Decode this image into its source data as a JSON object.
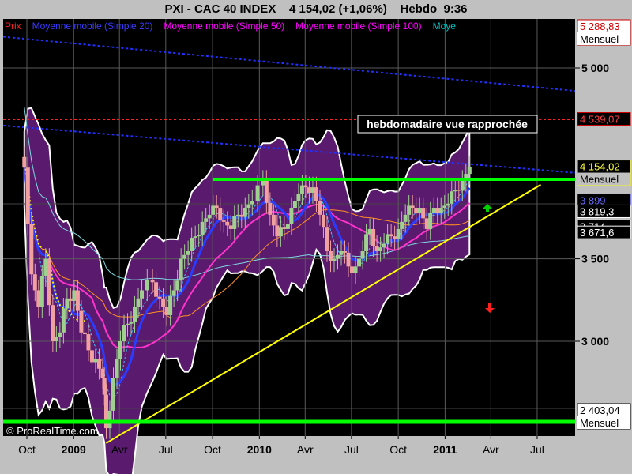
{
  "title": "PXI - CAC 40 INDEX    4 154,02 (+1,06%)    Hebdo  9:36",
  "watermark": "© ProRealTime.com",
  "annotation": "hebdomadaire vue rapprochée",
  "legend": [
    {
      "text": "Prix",
      "color": "#ff2020"
    },
    {
      "text": "Moyenne mobile (Simple 20)",
      "color": "#3a3aff"
    },
    {
      "text": "Moyenne mobile (Simple 50)",
      "color": "#ff00ff"
    },
    {
      "text": "Moyenne mobile (Simple 100)",
      "color": "#ff00ff"
    },
    {
      "text": "Moye",
      "color": "#00c0c0"
    }
  ],
  "colors": {
    "plot_bg": "#000000",
    "frame_bg": "#c0c0c0",
    "bollinger_fill": "#5a1a6e",
    "bollinger_edge": "#ffffff",
    "ma20": "#2a3cff",
    "ma50": "#ff33cc",
    "ma100": "#ff9020",
    "ma200": "#7fd8e0",
    "support_line": "#ffff00",
    "resistance_line": "#00ff00",
    "candle_up": "#a0d090",
    "candle_down": "#f0a0a0"
  },
  "chart_data": {
    "type": "candlestick",
    "title": "PXI - CAC 40 INDEX",
    "timeframe": "Hebdo",
    "last_price": 4154.02,
    "change_pct": 1.06,
    "y_axis": {
      "scale": "log",
      "min": 2330,
      "max": 5550,
      "ticks": [
        {
          "value": 5000,
          "label": "5 000"
        },
        {
          "value": 3500,
          "label": "3 500"
        },
        {
          "value": 3000,
          "label": "3 000"
        }
      ]
    },
    "x_axis": {
      "ticks": [
        {
          "date": "2008-10",
          "label": "Oct",
          "bold": false
        },
        {
          "date": "2009-01",
          "label": "2009",
          "bold": true
        },
        {
          "date": "2009-04",
          "label": "Avr",
          "bold": false
        },
        {
          "date": "2009-07",
          "label": "Jul",
          "bold": false
        },
        {
          "date": "2009-10",
          "label": "Oct",
          "bold": false
        },
        {
          "date": "2010-01",
          "label": "2010",
          "bold": true
        },
        {
          "date": "2010-04",
          "label": "Avr",
          "bold": false
        },
        {
          "date": "2010-07",
          "label": "Jul",
          "bold": false
        },
        {
          "date": "2010-10",
          "label": "Oct",
          "bold": false
        },
        {
          "date": "2011-01",
          "label": "2011",
          "bold": true
        },
        {
          "date": "2011-04",
          "label": "Avr",
          "bold": false
        },
        {
          "date": "2011-07",
          "label": "Jul",
          "bold": false
        }
      ]
    },
    "price_labels": [
      {
        "value": 5288.83,
        "label": "5 288,83",
        "sub": "Mensuel",
        "style": "white-box-red-text"
      },
      {
        "value": 4539.07,
        "label": "4 539,07",
        "sub": "",
        "style": "dark-box-red-text"
      },
      {
        "value": 4154.02,
        "label": "4 154,02",
        "sub": "Mensuel",
        "style": "dark-box-yellow-text"
      },
      {
        "value": 3899,
        "label": "3 899",
        "sub": "",
        "style": "dark-box-blue-text"
      },
      {
        "value": 3819.3,
        "label": "3 819,3",
        "sub": "",
        "style": "dark-box-white-text"
      },
      {
        "value": 3714,
        "label": "3 714",
        "sub": "",
        "style": "dark-box-white-text"
      },
      {
        "value": 3671.6,
        "label": "3 671,6",
        "sub": "",
        "style": "dark-box-white-text"
      },
      {
        "value": 2403.04,
        "label": "2 403,04",
        "sub": "Mensuel",
        "style": "white-box-black-text"
      }
    ],
    "candles_weekly_close": [
      {
        "date": "2008-09-26",
        "close": 4150
      },
      {
        "date": "2008-10-10",
        "close": 3400
      },
      {
        "date": "2008-10-24",
        "close": 3200
      },
      {
        "date": "2008-11-07",
        "close": 3500
      },
      {
        "date": "2008-11-21",
        "close": 3000
      },
      {
        "date": "2008-12-05",
        "close": 3050
      },
      {
        "date": "2008-12-19",
        "close": 3250
      },
      {
        "date": "2009-01-02",
        "close": 3300
      },
      {
        "date": "2009-01-16",
        "close": 3050
      },
      {
        "date": "2009-01-30",
        "close": 2950
      },
      {
        "date": "2009-02-13",
        "close": 2900
      },
      {
        "date": "2009-02-27",
        "close": 2800
      },
      {
        "date": "2009-03-06",
        "close": 2550
      },
      {
        "date": "2009-03-20",
        "close": 2800
      },
      {
        "date": "2009-04-03",
        "close": 3000
      },
      {
        "date": "2009-04-17",
        "close": 3100
      },
      {
        "date": "2009-05-01",
        "close": 3200
      },
      {
        "date": "2009-05-15",
        "close": 3300
      },
      {
        "date": "2009-06-05",
        "close": 3350
      },
      {
        "date": "2009-06-19",
        "close": 3250
      },
      {
        "date": "2009-07-03",
        "close": 3150
      },
      {
        "date": "2009-07-17",
        "close": 3300
      },
      {
        "date": "2009-07-31",
        "close": 3500
      },
      {
        "date": "2009-08-14",
        "close": 3550
      },
      {
        "date": "2009-08-28",
        "close": 3650
      },
      {
        "date": "2009-09-11",
        "close": 3750
      },
      {
        "date": "2009-09-25",
        "close": 3800
      },
      {
        "date": "2009-10-09",
        "close": 3850
      },
      {
        "date": "2009-10-23",
        "close": 3750
      },
      {
        "date": "2009-11-06",
        "close": 3700
      },
      {
        "date": "2009-11-20",
        "close": 3800
      },
      {
        "date": "2009-12-04",
        "close": 3850
      },
      {
        "date": "2009-12-18",
        "close": 3900
      },
      {
        "date": "2010-01-08",
        "close": 4050
      },
      {
        "date": "2010-01-22",
        "close": 3800
      },
      {
        "date": "2010-02-05",
        "close": 3650
      },
      {
        "date": "2010-02-19",
        "close": 3700
      },
      {
        "date": "2010-03-05",
        "close": 3850
      },
      {
        "date": "2010-03-19",
        "close": 3950
      },
      {
        "date": "2010-04-02",
        "close": 4000
      },
      {
        "date": "2010-04-16",
        "close": 4000
      },
      {
        "date": "2010-04-30",
        "close": 3800
      },
      {
        "date": "2010-05-14",
        "close": 3550
      },
      {
        "date": "2010-05-28",
        "close": 3500
      },
      {
        "date": "2010-06-11",
        "close": 3550
      },
      {
        "date": "2010-06-25",
        "close": 3450
      },
      {
        "date": "2010-07-09",
        "close": 3450
      },
      {
        "date": "2010-07-23",
        "close": 3550
      },
      {
        "date": "2010-08-06",
        "close": 3700
      },
      {
        "date": "2010-08-20",
        "close": 3550
      },
      {
        "date": "2010-09-03",
        "close": 3600
      },
      {
        "date": "2010-09-17",
        "close": 3650
      },
      {
        "date": "2010-10-01",
        "close": 3700
      },
      {
        "date": "2010-10-15",
        "close": 3800
      },
      {
        "date": "2010-10-29",
        "close": 3850
      },
      {
        "date": "2010-11-12",
        "close": 3850
      },
      {
        "date": "2010-11-26",
        "close": 3700
      },
      {
        "date": "2010-12-10",
        "close": 3850
      },
      {
        "date": "2010-12-24",
        "close": 3850
      },
      {
        "date": "2011-01-07",
        "close": 3880
      },
      {
        "date": "2011-01-21",
        "close": 3980
      },
      {
        "date": "2011-02-04",
        "close": 4050
      },
      {
        "date": "2011-02-18",
        "close": 4154
      }
    ]
  }
}
